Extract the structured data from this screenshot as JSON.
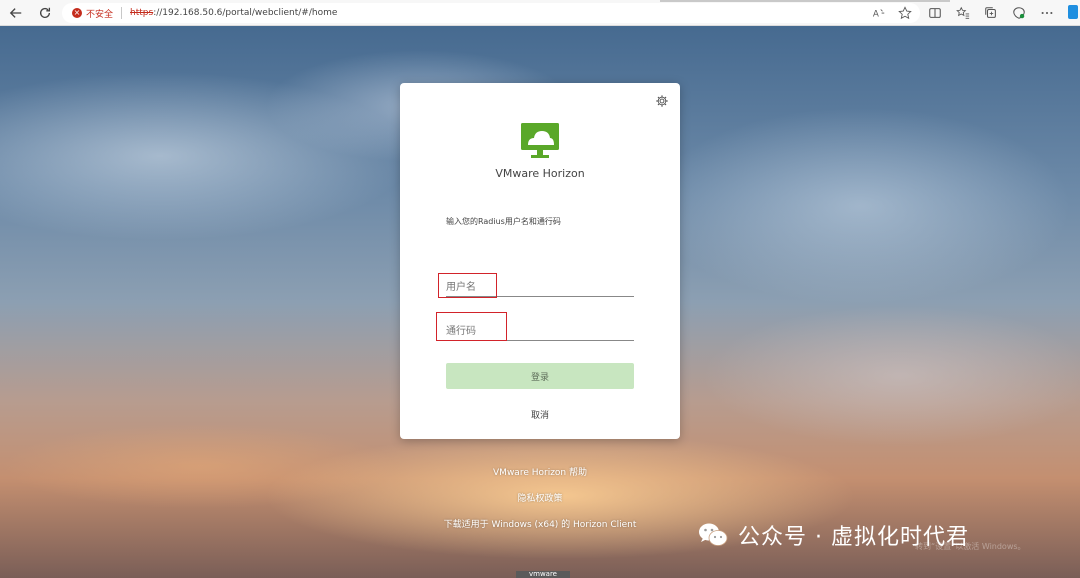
{
  "browser": {
    "security_text": "不安全",
    "url_scheme": "https",
    "url_rest": "://192.168.50.6/portal/webclient/#/home"
  },
  "card": {
    "product_name": "VMware Horizon",
    "instruction": "输入您的Radius用户名和通行码",
    "username_placeholder": "用户名",
    "passcode_placeholder": "通行码",
    "login_label": "登录",
    "cancel_label": "取消"
  },
  "links": {
    "help": "VMware Horizon 帮助",
    "privacy": "隐私权政策",
    "download": "下载适用于 Windows (x64) 的 Horizon Client"
  },
  "watermark": {
    "text": "公众号 · 虚拟化时代君",
    "faded": "转到“设置”以激活 Windows。"
  },
  "footer": {
    "vmware_badge": "vmware"
  },
  "colors": {
    "accent_green": "#5aa829",
    "login_disabled": "#c8e6c0",
    "annotation_red": "#d2232a"
  }
}
